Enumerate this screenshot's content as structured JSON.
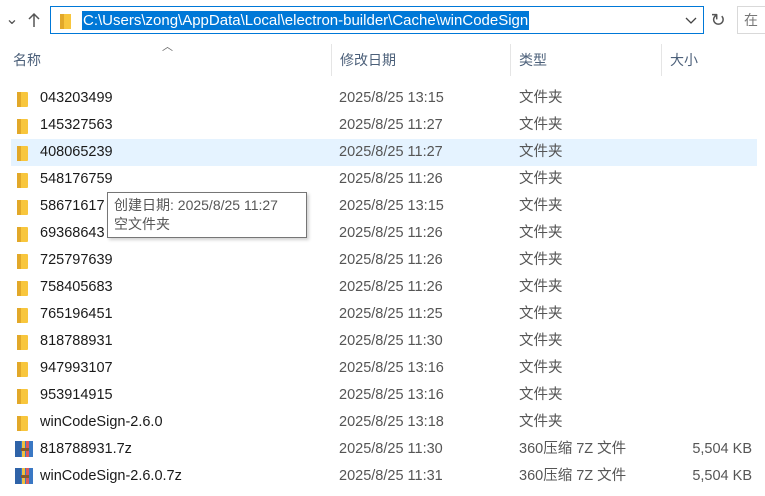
{
  "address_bar": {
    "path": "C:\\Users\\zong\\AppData\\Local\\electron-builder\\Cache\\winCodeSign",
    "dropdown_icon": "chevron-down-icon",
    "refresh_icon": "refresh-icon",
    "up_icon": "arrow-up-icon",
    "search_placeholder": "在"
  },
  "columns": {
    "name": "名称",
    "date": "修改日期",
    "type": "类型",
    "size": "大小"
  },
  "files": [
    {
      "name": "043203499",
      "date": "2025/8/25 13:15",
      "type": "文件夹",
      "size": "",
      "icon": "folder-icon"
    },
    {
      "name": "145327563",
      "date": "2025/8/25 11:27",
      "type": "文件夹",
      "size": "",
      "icon": "folder-icon"
    },
    {
      "name": "408065239",
      "date": "2025/8/25 11:27",
      "type": "文件夹",
      "size": "",
      "icon": "folder-icon",
      "selected": true
    },
    {
      "name": "548176759",
      "date": "2025/8/25 11:26",
      "type": "文件夹",
      "size": "",
      "icon": "folder-icon"
    },
    {
      "name": "58671617",
      "date": "2025/8/25 13:15",
      "type": "文件夹",
      "size": "",
      "icon": "folder-icon"
    },
    {
      "name": "69368643",
      "date": "2025/8/25 11:26",
      "type": "文件夹",
      "size": "",
      "icon": "folder-icon"
    },
    {
      "name": "725797639",
      "date": "2025/8/25 11:26",
      "type": "文件夹",
      "size": "",
      "icon": "folder-icon"
    },
    {
      "name": "758405683",
      "date": "2025/8/25 11:26",
      "type": "文件夹",
      "size": "",
      "icon": "folder-icon"
    },
    {
      "name": "765196451",
      "date": "2025/8/25 11:25",
      "type": "文件夹",
      "size": "",
      "icon": "folder-icon"
    },
    {
      "name": "818788931",
      "date": "2025/8/25 11:30",
      "type": "文件夹",
      "size": "",
      "icon": "folder-icon"
    },
    {
      "name": "947993107",
      "date": "2025/8/25 13:16",
      "type": "文件夹",
      "size": "",
      "icon": "folder-icon"
    },
    {
      "name": "953914915",
      "date": "2025/8/25 13:16",
      "type": "文件夹",
      "size": "",
      "icon": "folder-icon"
    },
    {
      "name": "winCodeSign-2.6.0",
      "date": "2025/8/25 13:18",
      "type": "文件夹",
      "size": "",
      "icon": "folder-icon"
    },
    {
      "name": "818788931.7z",
      "date": "2025/8/25 11:30",
      "type": "360压缩 7Z 文件",
      "size": "5,504 KB",
      "icon": "archive-icon"
    },
    {
      "name": "winCodeSign-2.6.0.7z",
      "date": "2025/8/25 11:31",
      "type": "360压缩 7Z 文件",
      "size": "5,504 KB",
      "icon": "archive-icon"
    }
  ],
  "tooltip": {
    "line1": "创建日期: 2025/8/25 11:27",
    "line2": "空文件夹"
  },
  "colors": {
    "accent": "#0078d7",
    "selection": "#e5f3ff",
    "header_text": "#4c607a",
    "folder": "#f8c63d"
  }
}
